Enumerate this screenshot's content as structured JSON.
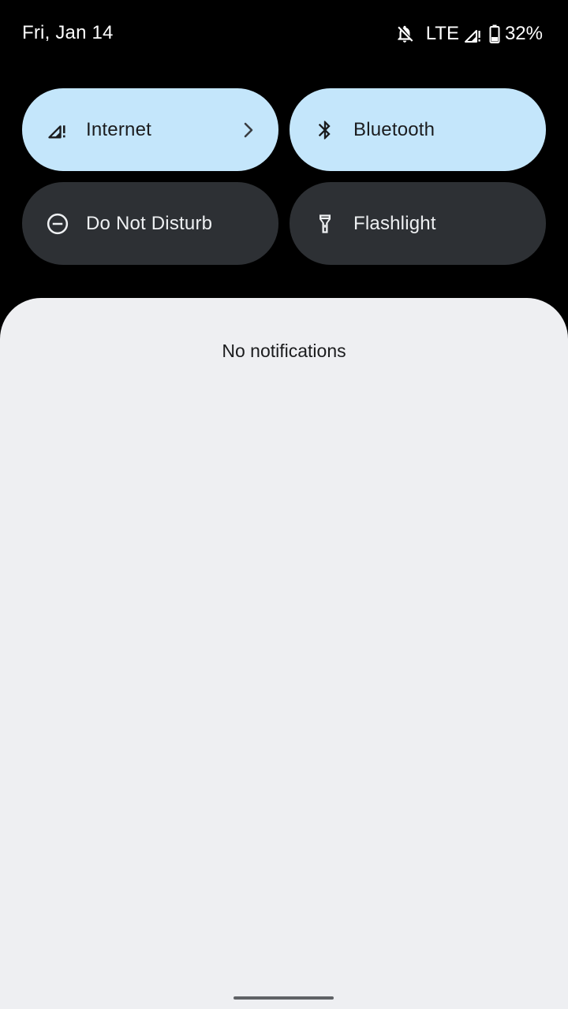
{
  "status_bar": {
    "date": "Fri, Jan 14",
    "network": "LTE",
    "battery": "32%",
    "icons": [
      "bell-off-icon",
      "signal-icon",
      "battery-icon"
    ]
  },
  "quick_settings": {
    "tiles": [
      {
        "label": "Internet",
        "icon": "signal-icon",
        "active": true,
        "has_chevron": true
      },
      {
        "label": "Bluetooth",
        "icon": "bluetooth-icon",
        "active": true
      },
      {
        "label": "Do Not Disturb",
        "icon": "dnd-icon",
        "active": false
      },
      {
        "label": "Flashlight",
        "icon": "flashlight-icon",
        "active": false
      }
    ]
  },
  "notifications": {
    "empty_text": "No notifications"
  },
  "colors": {
    "background": "#000000",
    "tile_active": "#c4e6fb",
    "tile_inactive": "#2d3034",
    "shade": "#eeeff2"
  }
}
